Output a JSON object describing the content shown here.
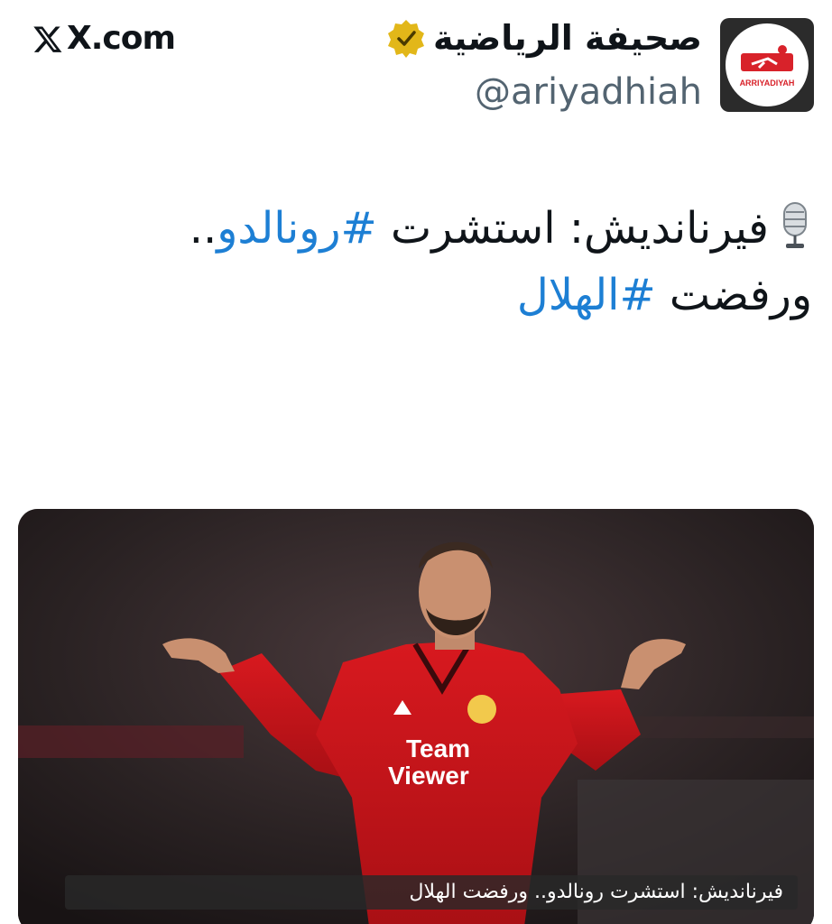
{
  "brand": {
    "site": "X.com",
    "icon": "x-logo-icon"
  },
  "account": {
    "display_name": "صحيفة الرياضية",
    "handle": "@ariyadhiah",
    "verified_icon": "gold-verified-badge-icon",
    "avatar_text": "ARRIYADIYAH"
  },
  "tweet": {
    "emoji_icon": "microphone-icon",
    "part1": "فيرنانديش: استشرت ",
    "tag1": "#رونالدو",
    "part2": ".. ورفضت ",
    "tag2": "#الهلال"
  },
  "media": {
    "caption": "فيرنانديش: استشرت رونالدو.. ورفضت الهلال",
    "shirt_sponsor_line1": "Team",
    "shirt_sponsor_line2": "Viewer"
  },
  "colors": {
    "hashtag": "#1d7fd4",
    "shirt_red": "#c8141a",
    "verified_gold": "#e2b719"
  }
}
